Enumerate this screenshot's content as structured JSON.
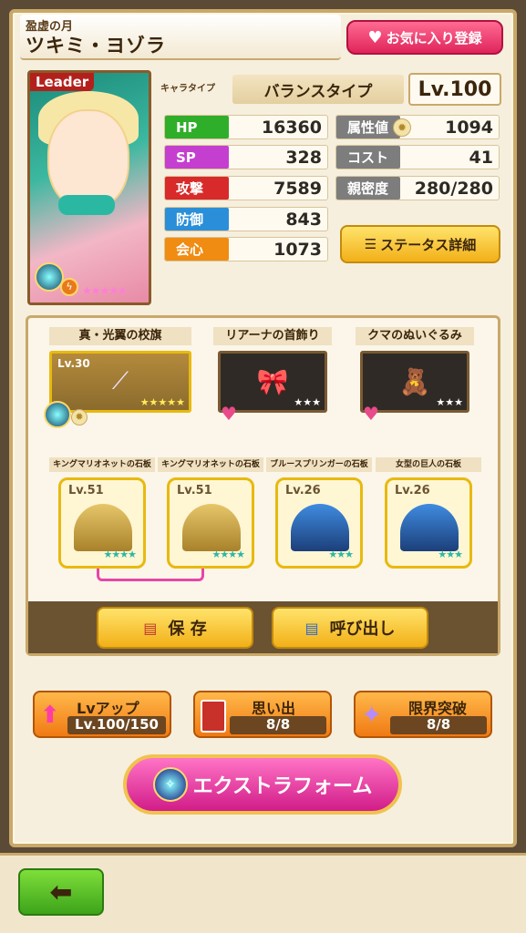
{
  "header": {
    "subtitle": "盈虚の月",
    "name": "ツキミ・ヨゾラ",
    "favorite_label": "お気に入り登録"
  },
  "portrait": {
    "leader_label": "Leader",
    "rarity_stars": "★★★★★"
  },
  "profile": {
    "type_label": "キャラタイプ",
    "type_value": "バランスタイプ",
    "level": "Lv.100"
  },
  "stats_left": [
    {
      "label": "HP",
      "value": "16360",
      "color": "#2fae2a"
    },
    {
      "label": "SP",
      "value": "328",
      "color": "#c43fd0"
    },
    {
      "label": "攻撃",
      "value": "7589",
      "color": "#d82a2a"
    },
    {
      "label": "防御",
      "value": "843",
      "color": "#2a8fd8"
    },
    {
      "label": "会心",
      "value": "1073",
      "color": "#f08c12"
    }
  ],
  "stats_right": [
    {
      "label": "属性値",
      "value": "1094",
      "color": "#7d7d7d"
    },
    {
      "label": "コスト",
      "value": "41",
      "color": "#7d7d7d"
    },
    {
      "label": "親密度",
      "value": "280/280",
      "color": "#7d7d7d"
    }
  ],
  "status_detail_label": "ステータス詳細",
  "equipment": [
    {
      "name": "真・光翼の校旗",
      "level": "Lv.30",
      "stars": "★★★★★"
    },
    {
      "name": "リアーナの首飾り",
      "level": "",
      "stars": "★★★"
    },
    {
      "name": "クマのぬいぐるみ",
      "level": "",
      "stars": "★★★"
    }
  ],
  "tablets": [
    {
      "name": "キングマリオネットの石板",
      "level": "Lv.51",
      "stars": "★★★★"
    },
    {
      "name": "キングマリオネットの石板",
      "level": "Lv.51",
      "stars": "★★★★"
    },
    {
      "name": "ブルースプリンガーの石板",
      "level": "Lv.26",
      "stars": "★★★"
    },
    {
      "name": "女型の巨人の石板",
      "level": "Lv.26",
      "stars": "★★★"
    }
  ],
  "save_label": "保 存",
  "load_label": "呼び出し",
  "actions": {
    "levelup_label": "Lvアップ",
    "levelup_value": "Lv.100/150",
    "memory_label": "思い出",
    "memory_value": "8/8",
    "limit_label": "限界突破",
    "limit_value": "8/8"
  },
  "extra_form_label": "エクストラフォーム"
}
